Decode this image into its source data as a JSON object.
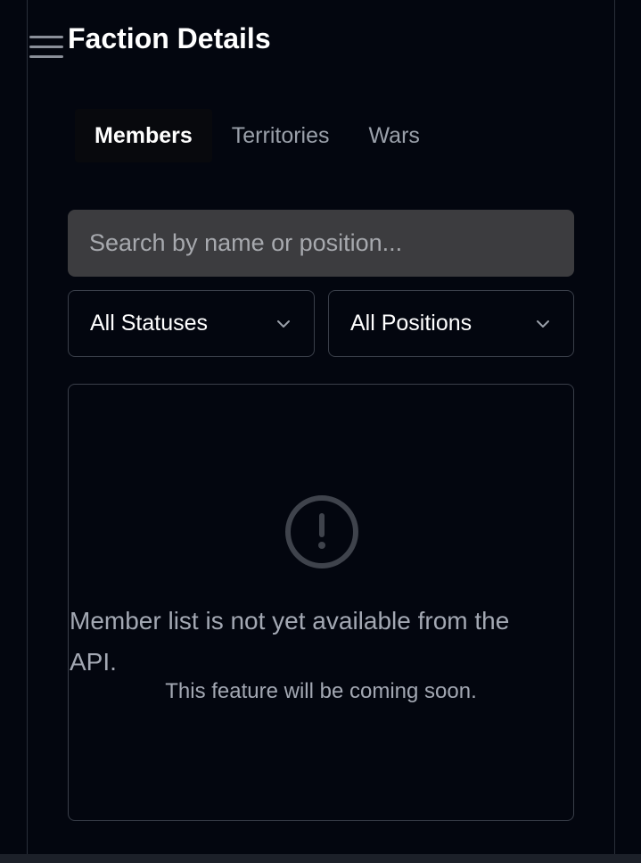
{
  "header": {
    "title": "Faction Details",
    "menu_icon": "hamburger-menu-icon"
  },
  "tabs": [
    {
      "label": "Members",
      "active": true
    },
    {
      "label": "Territories",
      "active": false
    },
    {
      "label": "Wars",
      "active": false
    }
  ],
  "search": {
    "placeholder": "Search by name or position...",
    "value": ""
  },
  "filters": {
    "status": {
      "selected": "All Statuses",
      "icon": "chevron-down-icon"
    },
    "position": {
      "selected": "All Positions",
      "icon": "chevron-down-icon"
    }
  },
  "empty_state": {
    "icon": "alert-circle-icon",
    "message": "Member list is not yet available from the API.",
    "submessage": "This feature will be coming soon."
  },
  "colors": {
    "background": "#03060f",
    "active_tab": "#08090d",
    "search_bg": "#3c3c3f",
    "muted_text": "#a3a8b3",
    "border": "#3a3f4a"
  }
}
